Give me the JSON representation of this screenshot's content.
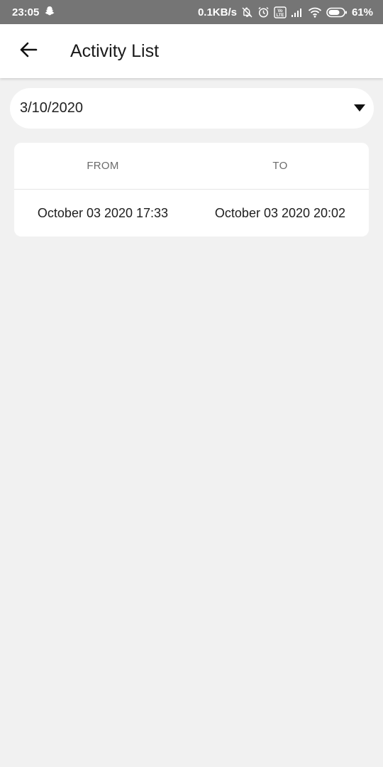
{
  "status_bar": {
    "time": "23:05",
    "network_speed": "0.1KB/s",
    "battery_percent": "61%",
    "icons": [
      "snapchat-icon",
      "bell-off-icon",
      "alarm-icon",
      "volte-icon",
      "signal-icon",
      "wifi-icon",
      "battery-icon"
    ]
  },
  "app_bar": {
    "title": "Activity List",
    "back_icon": "arrow-left-icon"
  },
  "date_select": {
    "value": "3/10/2020",
    "icon": "dropdown-triangle-icon"
  },
  "activity_table": {
    "columns": [
      "FROM",
      "TO"
    ],
    "rows": [
      [
        "October 03 2020 17:33",
        "October 03 2020 20:02"
      ]
    ]
  },
  "colors": {
    "status_bar_bg": "#757575",
    "page_bg": "#f1f1f1",
    "surface": "#ffffff"
  }
}
